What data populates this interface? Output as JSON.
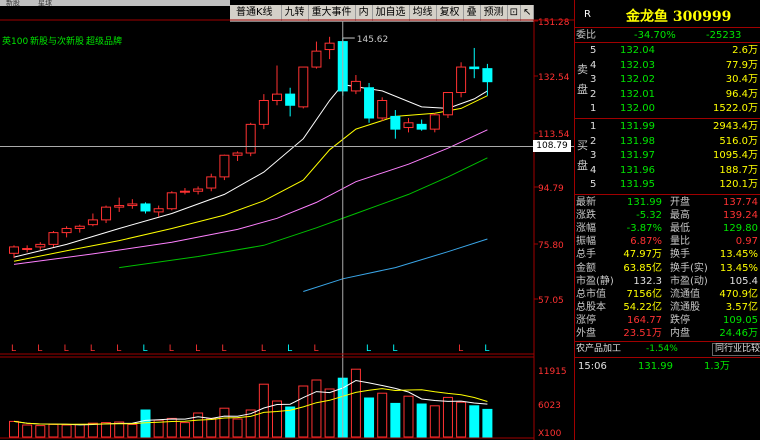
{
  "topstrip": {
    "items": [
      "新股",
      "星球"
    ]
  },
  "toolbar": {
    "buttons": [
      "普通K线",
      "九转",
      "重大事件",
      "内",
      "加自选",
      "均线",
      "复权",
      "叠",
      "预测",
      "⊡",
      "↖"
    ]
  },
  "indicator_legend": {
    "items": [
      "英100",
      "新股与次新股",
      "超级品牌"
    ]
  },
  "price_axis": {
    "labels": [
      "151.28",
      "132.54",
      "113.54",
      "94.79",
      "75.80",
      "57.05"
    ]
  },
  "volume_axis": {
    "labels": [
      "11915",
      "6023",
      "X100"
    ]
  },
  "crosshair": {
    "price": "108.79",
    "high_label": "145.62"
  },
  "colors": {
    "up": "#ff3232",
    "down": "#00ffff",
    "ma5": "#ffffff",
    "ma10": "#ffff00",
    "ma20": "#ff80ff",
    "ma30": "#00c000",
    "ma60": "#3aa6e8"
  },
  "chart_data": {
    "type": "candlestick",
    "ylim": [
      57.05,
      151.28
    ],
    "candles": [
      {
        "o": 78.0,
        "h": 80.5,
        "l": 76.5,
        "c": 80.0
      },
      {
        "o": 79.5,
        "h": 80.5,
        "l": 78.3,
        "c": 79.5
      },
      {
        "o": 80.0,
        "h": 81.5,
        "l": 79.0,
        "c": 80.8
      },
      {
        "o": 80.8,
        "h": 85.0,
        "l": 80.0,
        "c": 84.5
      },
      {
        "o": 84.5,
        "h": 86.5,
        "l": 83.0,
        "c": 85.8
      },
      {
        "o": 85.8,
        "h": 87.0,
        "l": 84.5,
        "c": 86.5
      },
      {
        "o": 87.0,
        "h": 90.5,
        "l": 86.5,
        "c": 88.5
      },
      {
        "o": 88.5,
        "h": 93.0,
        "l": 87.5,
        "c": 92.5
      },
      {
        "o": 92.5,
        "h": 95.5,
        "l": 91.0,
        "c": 93.0
      },
      {
        "o": 93.0,
        "h": 95.0,
        "l": 92.0,
        "c": 93.5
      },
      {
        "o": 93.5,
        "h": 94.0,
        "l": 90.5,
        "c": 91.3
      },
      {
        "o": 91.0,
        "h": 93.0,
        "l": 89.5,
        "c": 92.0
      },
      {
        "o": 92.0,
        "h": 97.5,
        "l": 91.5,
        "c": 97.0
      },
      {
        "o": 97.5,
        "h": 98.5,
        "l": 96.5,
        "c": 97.5
      },
      {
        "o": 97.5,
        "h": 99.0,
        "l": 96.5,
        "c": 98.2
      },
      {
        "o": 98.5,
        "h": 103.0,
        "l": 97.5,
        "c": 102.0
      },
      {
        "o": 102.0,
        "h": 109.0,
        "l": 101.0,
        "c": 108.8
      },
      {
        "o": 108.8,
        "h": 110.0,
        "l": 107.0,
        "c": 109.5
      },
      {
        "o": 109.5,
        "h": 119.0,
        "l": 108.5,
        "c": 118.5
      },
      {
        "o": 118.5,
        "h": 128.0,
        "l": 117.0,
        "c": 126.0
      },
      {
        "o": 126.0,
        "h": 137.0,
        "l": 124.5,
        "c": 128.0
      },
      {
        "o": 128.0,
        "h": 130.0,
        "l": 121.0,
        "c": 124.5
      },
      {
        "o": 124.0,
        "h": 136.5,
        "l": 123.5,
        "c": 136.5
      },
      {
        "o": 136.5,
        "h": 144.5,
        "l": 136.0,
        "c": 141.5
      },
      {
        "o": 142.0,
        "h": 146.0,
        "l": 139.0,
        "c": 144.0
      },
      {
        "o": 144.5,
        "h": 145.6,
        "l": 127.5,
        "c": 129.0
      },
      {
        "o": 129.0,
        "h": 134.0,
        "l": 128.0,
        "c": 132.0
      },
      {
        "o": 130.0,
        "h": 131.5,
        "l": 119.0,
        "c": 120.5
      },
      {
        "o": 120.5,
        "h": 127.0,
        "l": 119.5,
        "c": 126.0
      },
      {
        "o": 121.0,
        "h": 123.0,
        "l": 114.0,
        "c": 117.0
      },
      {
        "o": 117.5,
        "h": 120.5,
        "l": 116.0,
        "c": 119.0
      },
      {
        "o": 118.5,
        "h": 120.0,
        "l": 116.5,
        "c": 117.0
      },
      {
        "o": 117.0,
        "h": 122.0,
        "l": 116.0,
        "c": 121.5
      },
      {
        "o": 121.5,
        "h": 128.5,
        "l": 120.5,
        "c": 128.5
      },
      {
        "o": 128.5,
        "h": 138.0,
        "l": 127.0,
        "c": 136.5
      },
      {
        "o": 136.5,
        "h": 142.5,
        "l": 133.0,
        "c": 136.0
      },
      {
        "o": 136.0,
        "h": 137.5,
        "l": 127.5,
        "c": 131.9
      }
    ],
    "ma5": [
      [
        0,
        76.8
      ],
      [
        4,
        80.8
      ],
      [
        8,
        85.8
      ],
      [
        12,
        90.5
      ],
      [
        16,
        96.5
      ],
      [
        19,
        103.5
      ],
      [
        22,
        114.0
      ],
      [
        24,
        126.0
      ],
      [
        25,
        131.0
      ],
      [
        28,
        129.0
      ],
      [
        31,
        124.0
      ],
      [
        33,
        123.5
      ],
      [
        35,
        126.5
      ],
      [
        36,
        129.0
      ]
    ],
    "ma10": [
      [
        0,
        75.5
      ],
      [
        4,
        78.8
      ],
      [
        8,
        82.0
      ],
      [
        12,
        85.8
      ],
      [
        16,
        90.0
      ],
      [
        19,
        94.5
      ],
      [
        22,
        101.0
      ],
      [
        24,
        110.5
      ],
      [
        26,
        117.0
      ],
      [
        29,
        121.0
      ],
      [
        32,
        122.0
      ],
      [
        34,
        123.5
      ],
      [
        36,
        127.5
      ]
    ],
    "ma20": [
      [
        0,
        74.5
      ],
      [
        6,
        77.8
      ],
      [
        12,
        81.5
      ],
      [
        17,
        85.5
      ],
      [
        20,
        89.0
      ],
      [
        23,
        94.0
      ],
      [
        26,
        100.5
      ],
      [
        30,
        106.0
      ],
      [
        33,
        111.0
      ],
      [
        36,
        116.8
      ]
    ],
    "ma30": [
      [
        8,
        73.5
      ],
      [
        14,
        77.0
      ],
      [
        19,
        80.5
      ],
      [
        23,
        86.0
      ],
      [
        26,
        90.5
      ],
      [
        30,
        96.5
      ],
      [
        33,
        102.0
      ],
      [
        36,
        108.0
      ]
    ],
    "ma60": [
      [
        22,
        66.0
      ],
      [
        25,
        70.0
      ],
      [
        29,
        73.5
      ],
      [
        33,
        78.5
      ],
      [
        36,
        82.5
      ]
    ],
    "volumes": [
      2600,
      2000,
      1900,
      2100,
      2000,
      2100,
      2300,
      2400,
      2500,
      2100,
      4500,
      2800,
      3100,
      2400,
      4000,
      3100,
      4800,
      3000,
      4500,
      8800,
      6000,
      5000,
      8500,
      9500,
      8000,
      9800,
      11300,
      6500,
      7300,
      5600,
      6800,
      5500,
      5200,
      6600,
      5800,
      5200,
      4600
    ]
  },
  "panel": {
    "title_r": "R",
    "title_name": "金龙鱼 300999",
    "weibi": {
      "label": "委比",
      "pct": "-34.70%",
      "val": "-25233"
    },
    "sell_label": "卖\n盘",
    "sells": [
      {
        "lvl": "5",
        "price": "132.04",
        "vol": "2.6万"
      },
      {
        "lvl": "4",
        "price": "132.03",
        "vol": "77.9万"
      },
      {
        "lvl": "3",
        "price": "132.02",
        "vol": "30.4万"
      },
      {
        "lvl": "2",
        "price": "132.01",
        "vol": "96.4万"
      },
      {
        "lvl": "1",
        "price": "132.00",
        "vol": "1522.0万"
      }
    ],
    "buy_label": "买\n盘",
    "buys": [
      {
        "lvl": "1",
        "price": "131.99",
        "vol": "2943.4万"
      },
      {
        "lvl": "2",
        "price": "131.98",
        "vol": "516.0万"
      },
      {
        "lvl": "3",
        "price": "131.97",
        "vol": "1095.4万"
      },
      {
        "lvl": "4",
        "price": "131.96",
        "vol": "188.7万"
      },
      {
        "lvl": "5",
        "price": "131.95",
        "vol": "120.1万"
      }
    ],
    "stats": [
      {
        "k1": "最新",
        "v1": "131.99",
        "c1": "grn",
        "k2": "开盘",
        "v2": "137.74",
        "c2": "red"
      },
      {
        "k1": "涨跌",
        "v1": "-5.32",
        "c1": "grn",
        "k2": "最高",
        "v2": "139.24",
        "c2": "red"
      },
      {
        "k1": "涨幅",
        "v1": "-3.87%",
        "c1": "grn",
        "k2": "最低",
        "v2": "129.80",
        "c2": "grn"
      },
      {
        "k1": "振幅",
        "v1": "6.87%",
        "c1": "red",
        "k2": "量比",
        "v2": "0.97",
        "c2": "red"
      },
      {
        "k1": "总手",
        "v1": "47.97万",
        "c1": "yel",
        "k2": "换手",
        "v2": "13.45%",
        "c2": "yel"
      },
      {
        "k1": "金额",
        "v1": "63.85亿",
        "c1": "yel",
        "k2": "换手(实)",
        "v2": "13.45%",
        "c2": "yel"
      },
      {
        "k1": "市盈(静)",
        "v1": "132.3",
        "c1": "wht",
        "k2": "市盈(动)",
        "v2": "105.4",
        "c2": "wht"
      },
      {
        "k1": "总市值",
        "v1": "7156亿",
        "c1": "yel",
        "k2": "流通值",
        "v2": "470.9亿",
        "c2": "yel"
      },
      {
        "k1": "总股本",
        "v1": "54.22亿",
        "c1": "yel",
        "k2": "流通股",
        "v2": "3.57亿",
        "c2": "yel"
      },
      {
        "k1": "涨停",
        "v1": "164.77",
        "c1": "red",
        "k2": "跌停",
        "v2": "109.05",
        "c2": "grn"
      },
      {
        "k1": "外盘",
        "v1": "23.51万",
        "c1": "red",
        "k2": "内盘",
        "v2": "24.46万",
        "c2": "grn"
      }
    ],
    "industry": {
      "name": "农产品加工",
      "pct": "-1.54%",
      "compare": "同行业比较"
    },
    "tick": {
      "time": "15:06",
      "price": "131.99",
      "vol": "1.3万"
    }
  }
}
